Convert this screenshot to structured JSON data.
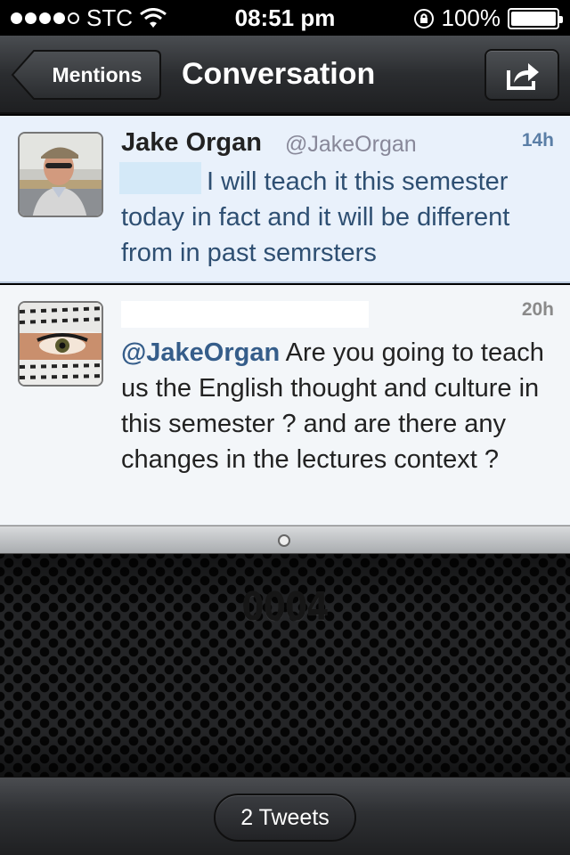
{
  "status_bar": {
    "carrier": "STC",
    "time": "08:51 pm",
    "battery": "100%",
    "signal_bars_filled": 4,
    "signal_bars_total": 5
  },
  "nav": {
    "back_label": "Mentions",
    "title": "Conversation",
    "share_icon": "share-icon"
  },
  "tweets": [
    {
      "author": "Jake Organ",
      "handle": "@JakeOrgan",
      "time": "14h",
      "text": "I will teach it this semester today in fact and it will be different from in past semrsters"
    },
    {
      "author": "",
      "handle": "",
      "time": "20h",
      "mention": "@JakeOrgan",
      "text": " Are you going to teach us the English thought and culture in this semester ? and are there any changes in the lectures context ?"
    }
  ],
  "drawer": {
    "counter": "0004"
  },
  "bottom": {
    "tweets_count": "2 Tweets"
  },
  "colors": {
    "highlight_row": "#e9f1fb",
    "link_blue": "#355d8a"
  }
}
